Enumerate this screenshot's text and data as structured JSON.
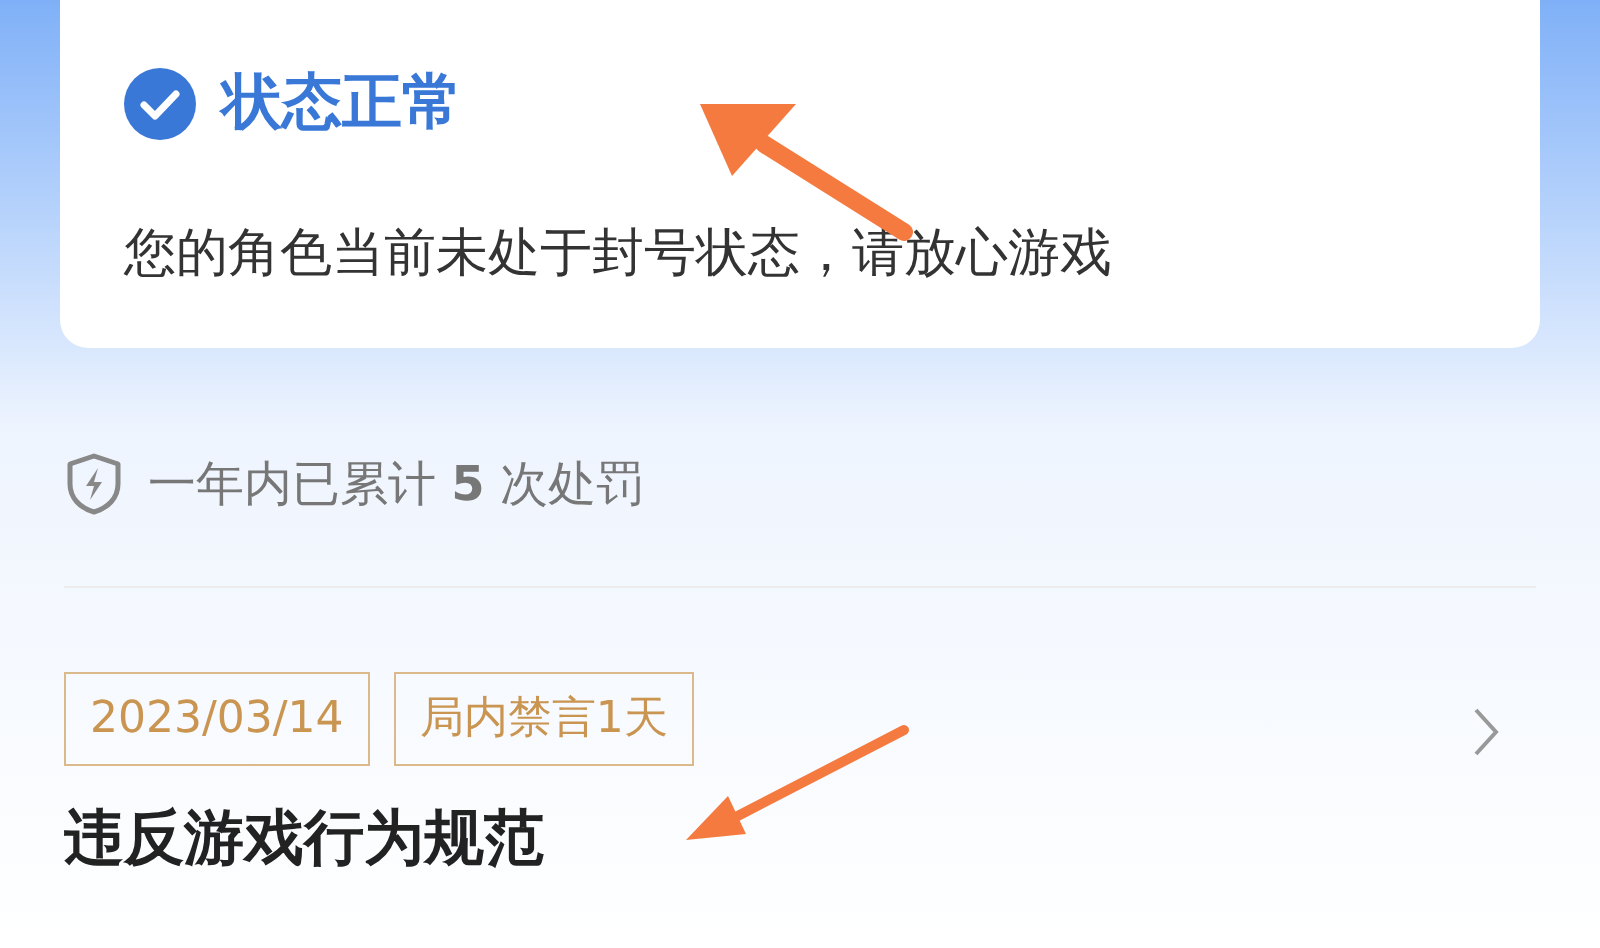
{
  "status_card": {
    "title": "状态正常",
    "message": "您的角色当前未处于封号状态，请放心游戏"
  },
  "summary": "一年内已累计 **5** 次处罚",
  "records": [
    {
      "tags": [
        "2023/03/14",
        "局内禁言1天"
      ],
      "title": "违反游戏行为规范"
    }
  ]
}
